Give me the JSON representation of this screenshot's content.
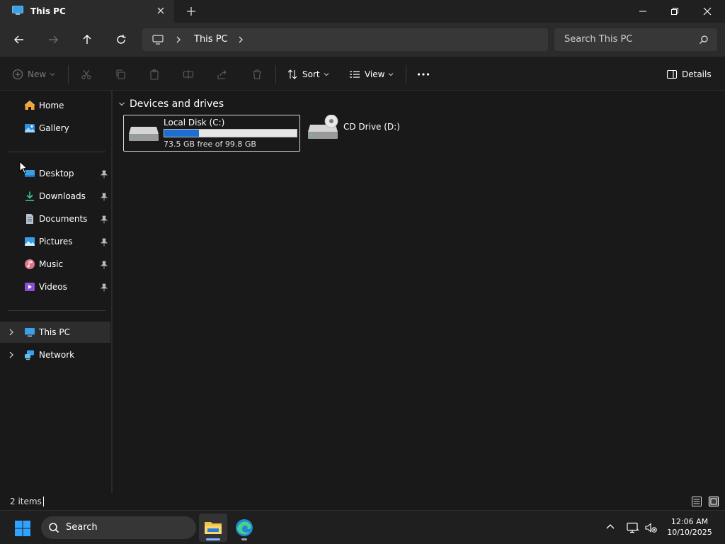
{
  "window": {
    "tab_title": "This PC",
    "controls": [
      "minimize",
      "restore",
      "close"
    ]
  },
  "address": {
    "crumbs": [
      "This PC"
    ],
    "search_placeholder": "Search This PC"
  },
  "commandbar": {
    "new_label": "New",
    "sort_label": "Sort",
    "view_label": "View",
    "details_label": "Details"
  },
  "sidebar": {
    "items": [
      {
        "label": "Home"
      },
      {
        "label": "Gallery"
      },
      {
        "label": "Desktop",
        "pinned": true
      },
      {
        "label": "Downloads",
        "pinned": true
      },
      {
        "label": "Documents",
        "pinned": true
      },
      {
        "label": "Pictures",
        "pinned": true
      },
      {
        "label": "Music",
        "pinned": true
      },
      {
        "label": "Videos",
        "pinned": true
      },
      {
        "label": "This PC",
        "selected": true
      },
      {
        "label": "Network"
      }
    ]
  },
  "content": {
    "group_title": "Devices and drives",
    "drives": [
      {
        "name": "Local Disk (C:)",
        "free_text": "73.5 GB free of 99.8 GB",
        "used_fraction": 0.264
      },
      {
        "name": "CD Drive (D:)"
      }
    ]
  },
  "status": {
    "item_count": "2 items"
  },
  "taskbar": {
    "search_label": "Search",
    "time": "12:06 AM",
    "date": "10/10/2025"
  },
  "colors": {
    "accent": "#1c6fd1",
    "background": "#191919"
  }
}
